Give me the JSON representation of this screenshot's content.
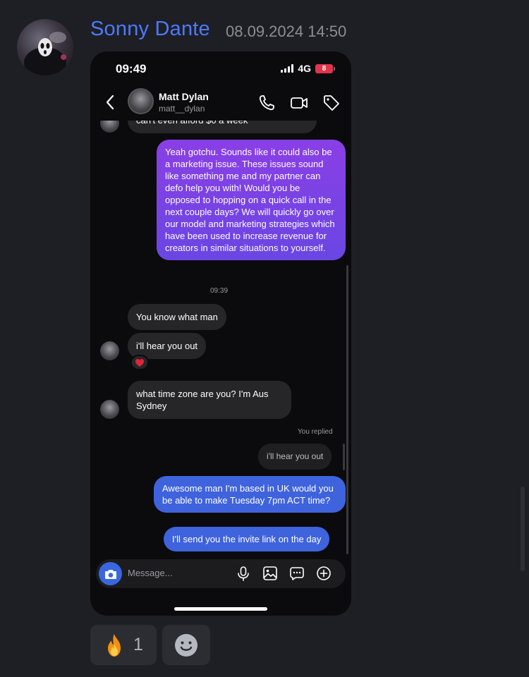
{
  "message": {
    "author": "Sonny Dante",
    "timestamp": "08.09.2024 14:50"
  },
  "phone": {
    "status_time": "09:49",
    "network": "4G",
    "battery": "8",
    "contact_name": "Matt Dylan",
    "contact_handle": "matt__dylan",
    "cut_off_message": "can't even afford $0 a week",
    "messages": {
      "pitch": "Yeah gotchu. Sounds like it could also be a marketing issue. These issues sound like something me and my partner can defo help you with! Would you be opposed to hopping on a quick call in the next couple days? We will quickly go over our model and marketing strategies which have been used to increase revenue for creators in similar situations to yourself.",
      "time_separator": "09:39",
      "reply1": "You know what man",
      "reply2": "i'll hear you out",
      "reply2_reaction": "❤️",
      "reply3": "what time zone are you? I'm Aus Sydney",
      "you_replied_label": "You replied",
      "quoted": "i'll hear you out",
      "answer1": "Awesome man I'm based in UK would you be able to make Tuesday 7pm ACT time?",
      "answer2": "I'll send you the invite link on the day"
    },
    "composer_placeholder": "Message..."
  },
  "reactions": [
    {
      "emoji": "🔥",
      "count": "1"
    }
  ],
  "colors": {
    "author": "#4c79ff",
    "outgoing_purple": "#8a3fe6",
    "outgoing_blue": "#3f63dd",
    "incoming": "#262629",
    "background": "#1e1f24"
  }
}
